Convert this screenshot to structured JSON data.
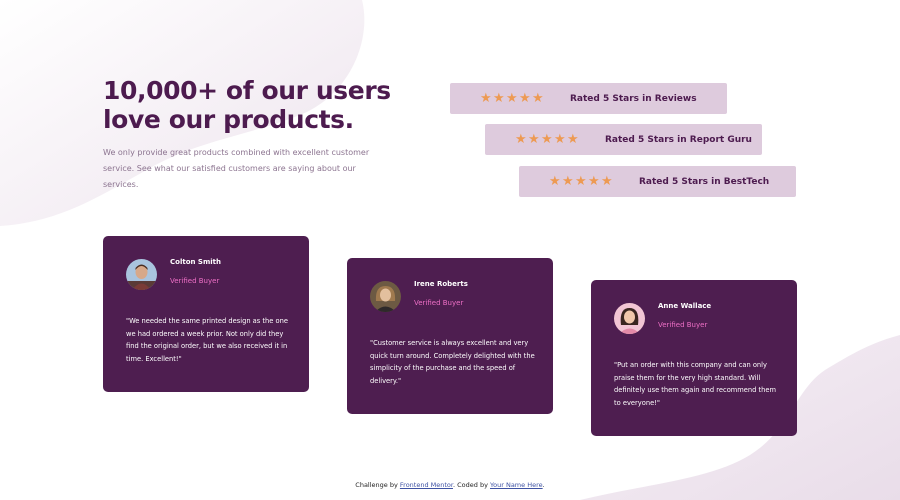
{
  "colors": {
    "accent_purple": "#4d1b4f",
    "rating_bg": "#decbdd",
    "star": "#ed9a53",
    "verified": "#ee6fc6",
    "body_text": "#8c7490"
  },
  "header": {
    "headline": "10,000+ of our users love our products.",
    "intro": "We only provide great products combined with excellent customer service. See what our satisfied customers are saying about our services."
  },
  "ratings": [
    {
      "stars": 5,
      "label": "Rated 5 Stars in Reviews",
      "icon": "star-icon"
    },
    {
      "stars": 5,
      "label": "Rated 5 Stars in Report Guru",
      "icon": "star-icon"
    },
    {
      "stars": 5,
      "label": "Rated 5 Stars in BestTech",
      "icon": "star-icon"
    }
  ],
  "testimonials": [
    {
      "name": "Colton Smith",
      "role": "Verified Buyer",
      "quote": "\"We needed the same printed design as the one we had ordered a week prior. Not only did they find the original order, but we also received it in time. Excellent!\""
    },
    {
      "name": "Irene Roberts",
      "role": "Verified Buyer",
      "quote": "\"Customer service is always excellent and very quick turn around. Completely delighted with the simplicity of the purchase and the speed of delivery.\""
    },
    {
      "name": "Anne Wallace",
      "role": "Verified Buyer",
      "quote": "\"Put an order with this company and can only praise them for the very high standard. Will definitely use them again and recommend them to everyone!\""
    }
  ],
  "footer": {
    "prefix": "Challenge by",
    "link1": "Frontend Mentor",
    "middle": ". Coded by",
    "link2": "Your Name Here",
    "suffix": "."
  }
}
